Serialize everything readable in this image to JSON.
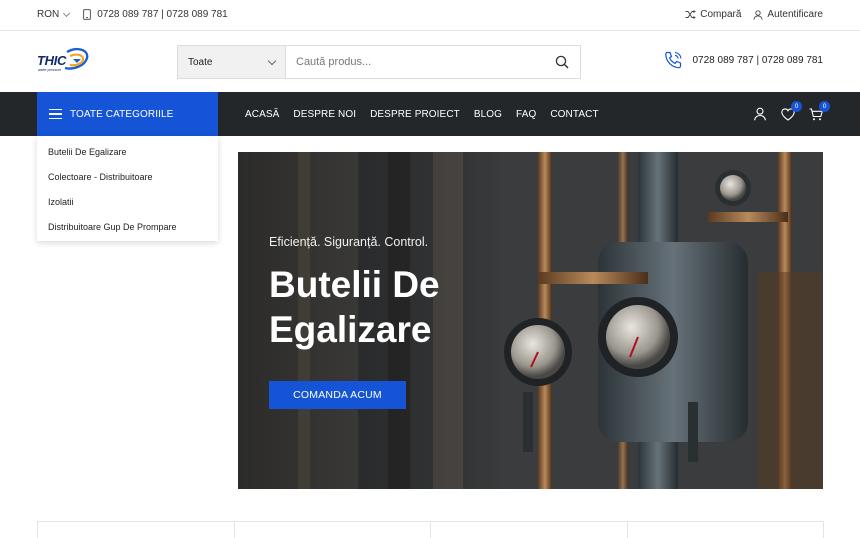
{
  "topbar": {
    "currency": "RON",
    "phones": "0728 089 787 | 0728 089 781",
    "compare": "Compară",
    "login": "Autentificare"
  },
  "header": {
    "logo_text": "THIC",
    "logo_sub": "water pressure",
    "search": {
      "category": "Toate",
      "placeholder": "Caută produs..."
    },
    "phones": "0728 089 787 | 0728 089 781"
  },
  "nav": {
    "all_categories": "TOATE CATEGORIILE",
    "menu": [
      "ACASĂ",
      "DESPRE NOI",
      "DESPRE PROIECT",
      "BLOG",
      "FAQ",
      "CONTACT"
    ],
    "wishlist_count": "0",
    "cart_count": "0"
  },
  "categories": [
    "Butelii De Egalizare",
    "Colectoare - Distribuitoare",
    "Izolatii",
    "Distribuitoare Gup De Prompare"
  ],
  "hero": {
    "tagline": "Eficiență. Siguranță. Control.",
    "title": "Butelii De Egalizare",
    "cta": "COMANDA ACUM"
  },
  "colors": {
    "accent": "#1554d6",
    "navbar": "#23272a",
    "brand_logo": "#102a6b"
  }
}
